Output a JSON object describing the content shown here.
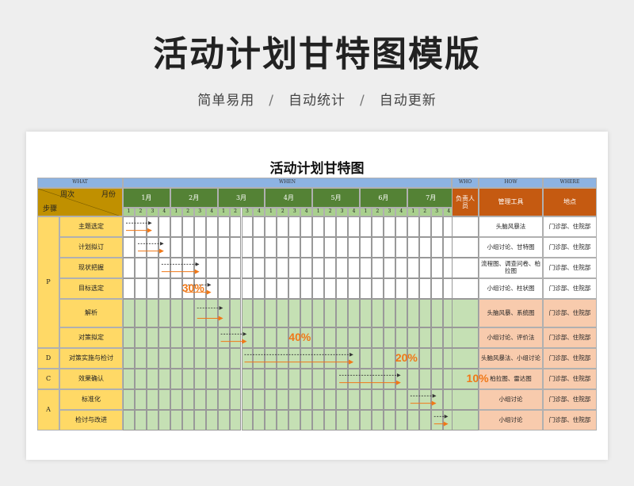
{
  "page": {
    "title": "活动计划甘特图模版",
    "subtitle_items": [
      "简单易用",
      "自动统计",
      "自动更新"
    ],
    "subtitle_separator": "/"
  },
  "gantt": {
    "title": "活动计划甘特图",
    "sections": {
      "what": "WHAT",
      "when": "WHEN",
      "who": "WHO",
      "how": "HOW",
      "where": "WHERE"
    },
    "header": {
      "week": "周次",
      "month": "月份",
      "step": "步骤",
      "owner": "负责人员",
      "tool": "管理工具",
      "place": "地点"
    },
    "months": [
      "1月",
      "2月",
      "3月",
      "4月",
      "5月",
      "6月",
      "7月"
    ],
    "weeks": [
      "1",
      "2",
      "3",
      "4"
    ],
    "phases": [
      {
        "label": "P",
        "rows": 6
      },
      {
        "label": "D",
        "rows": 1
      },
      {
        "label": "C",
        "rows": 1
      },
      {
        "label": "A",
        "rows": 2
      }
    ],
    "tasks": [
      {
        "name": "主题选定",
        "tool": "头脑风暴法",
        "place": "门诊部、住院部",
        "plan_start": 0,
        "plan_end": 2,
        "actual_start": 0,
        "actual_end": 2
      },
      {
        "name": "计划拟订",
        "tool": "小组讨论、甘特图",
        "place": "门诊部、住院部",
        "plan_start": 1,
        "plan_end": 3,
        "actual_start": 1,
        "actual_end": 3
      },
      {
        "name": "现状把握",
        "tool": "流程图、调查问卷、柏拉图",
        "place": "门诊部、住院部",
        "plan_start": 3,
        "plan_end": 6,
        "actual_start": 3,
        "actual_end": 6
      },
      {
        "name": "目标选定",
        "tool": "小组讨论、柱状图",
        "place": "门诊部、住院部",
        "plan_start": 5,
        "plan_end": 7,
        "actual_start": 5,
        "actual_end": 7
      },
      {
        "name": "解析",
        "tool": "头脑风暴、系统图",
        "place": "门诊部、住院部",
        "plan_start": 6,
        "plan_end": 8,
        "actual_start": 6,
        "actual_end": 8
      },
      {
        "name": "对策拟定",
        "tool": "小组讨论、评价法",
        "place": "门诊部、住院部",
        "plan_start": 8,
        "plan_end": 10,
        "actual_start": 8,
        "actual_end": 10
      },
      {
        "name": "对策实施与检讨",
        "tool": "头脑风暴法、小组讨论",
        "place": "门诊部、住院部",
        "plan_start": 10,
        "plan_end": 19,
        "actual_start": 10,
        "actual_end": 19
      },
      {
        "name": "效果确认",
        "tool": "柏拉图、雷达图",
        "place": "门诊部、住院部",
        "plan_start": 18,
        "plan_end": 23,
        "actual_start": 18,
        "actual_end": 23
      },
      {
        "name": "标准化",
        "tool": "小组讨论",
        "place": "门诊部、住院部",
        "plan_start": 24,
        "plan_end": 26,
        "actual_start": 24,
        "actual_end": 26
      },
      {
        "name": "检讨与改进",
        "tool": "小组讨论",
        "place": "门诊部、住院部",
        "plan_start": 26,
        "plan_end": 27,
        "actual_start": 26,
        "actual_end": 27
      }
    ],
    "percent_labels": [
      {
        "text": "30%",
        "row": 3,
        "week": 5
      },
      {
        "text": "40%",
        "row": 5,
        "week": 14
      },
      {
        "text": "20%",
        "row": 6,
        "week": 23
      },
      {
        "text": "10%",
        "row": 7,
        "week": 29
      }
    ],
    "colors": {
      "blue_header": "#8db3e2",
      "gold": "#c09000",
      "yellow": "#ffd966",
      "green_header": "#548235",
      "light_green": "#c5e0b4",
      "orange": "#c55a11",
      "peach": "#f8cbad",
      "arrow_plan": "#333333",
      "arrow_actual": "#f07818",
      "grid_line": "#999999",
      "percent": "#f07818"
    }
  }
}
